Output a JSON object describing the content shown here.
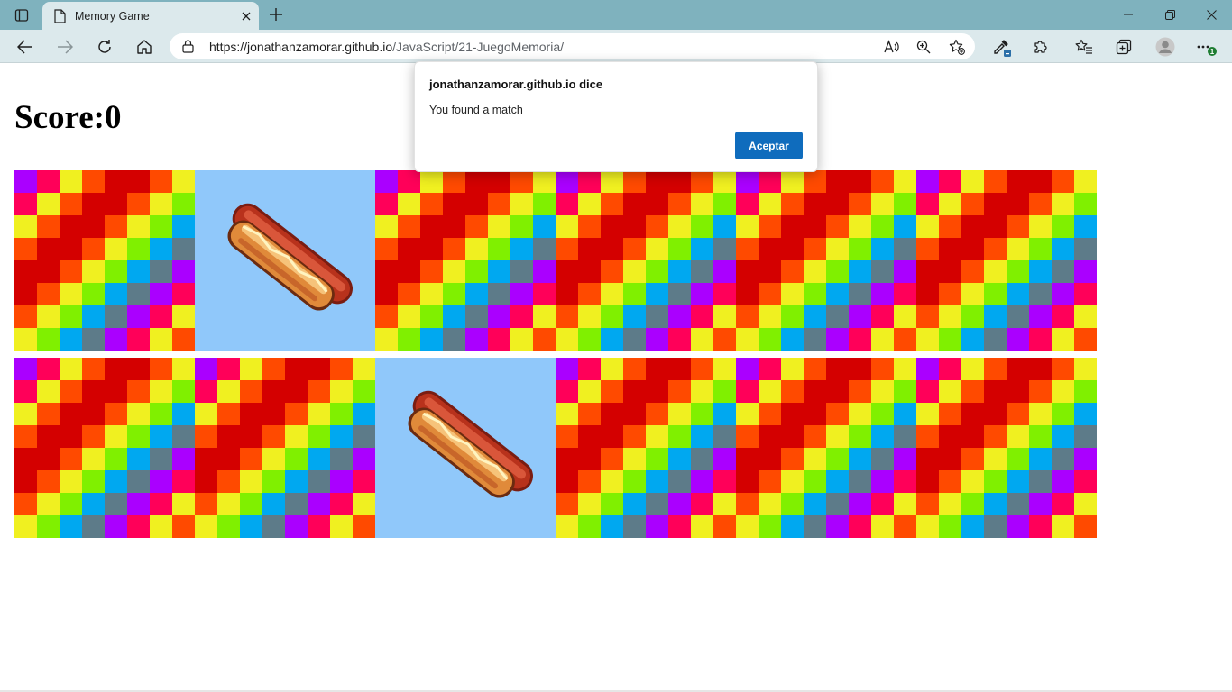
{
  "browser": {
    "tab": {
      "title": "Memory Game"
    },
    "url": {
      "host": "https://jonathanzamorar.github.io",
      "path": "/JavaScript/21-JuegoMemoria/"
    },
    "extension_badge": "1"
  },
  "game": {
    "score_label": "Score:",
    "score_value": "0",
    "rows": [
      [
        "back",
        "hotdog",
        "back",
        "back",
        "back",
        "back"
      ],
      [
        "back",
        "back",
        "hotdog",
        "back",
        "back",
        "back"
      ]
    ]
  },
  "dialog": {
    "title": "jonathanzamorar.github.io dice",
    "message": "You found a match",
    "button_label": "Aceptar"
  },
  "colors": {
    "titlebar": "#7fb2be",
    "toolbar": "#dce9ec",
    "accent": "#0f6cbd",
    "hotdog_bg": "#90c8fa"
  }
}
